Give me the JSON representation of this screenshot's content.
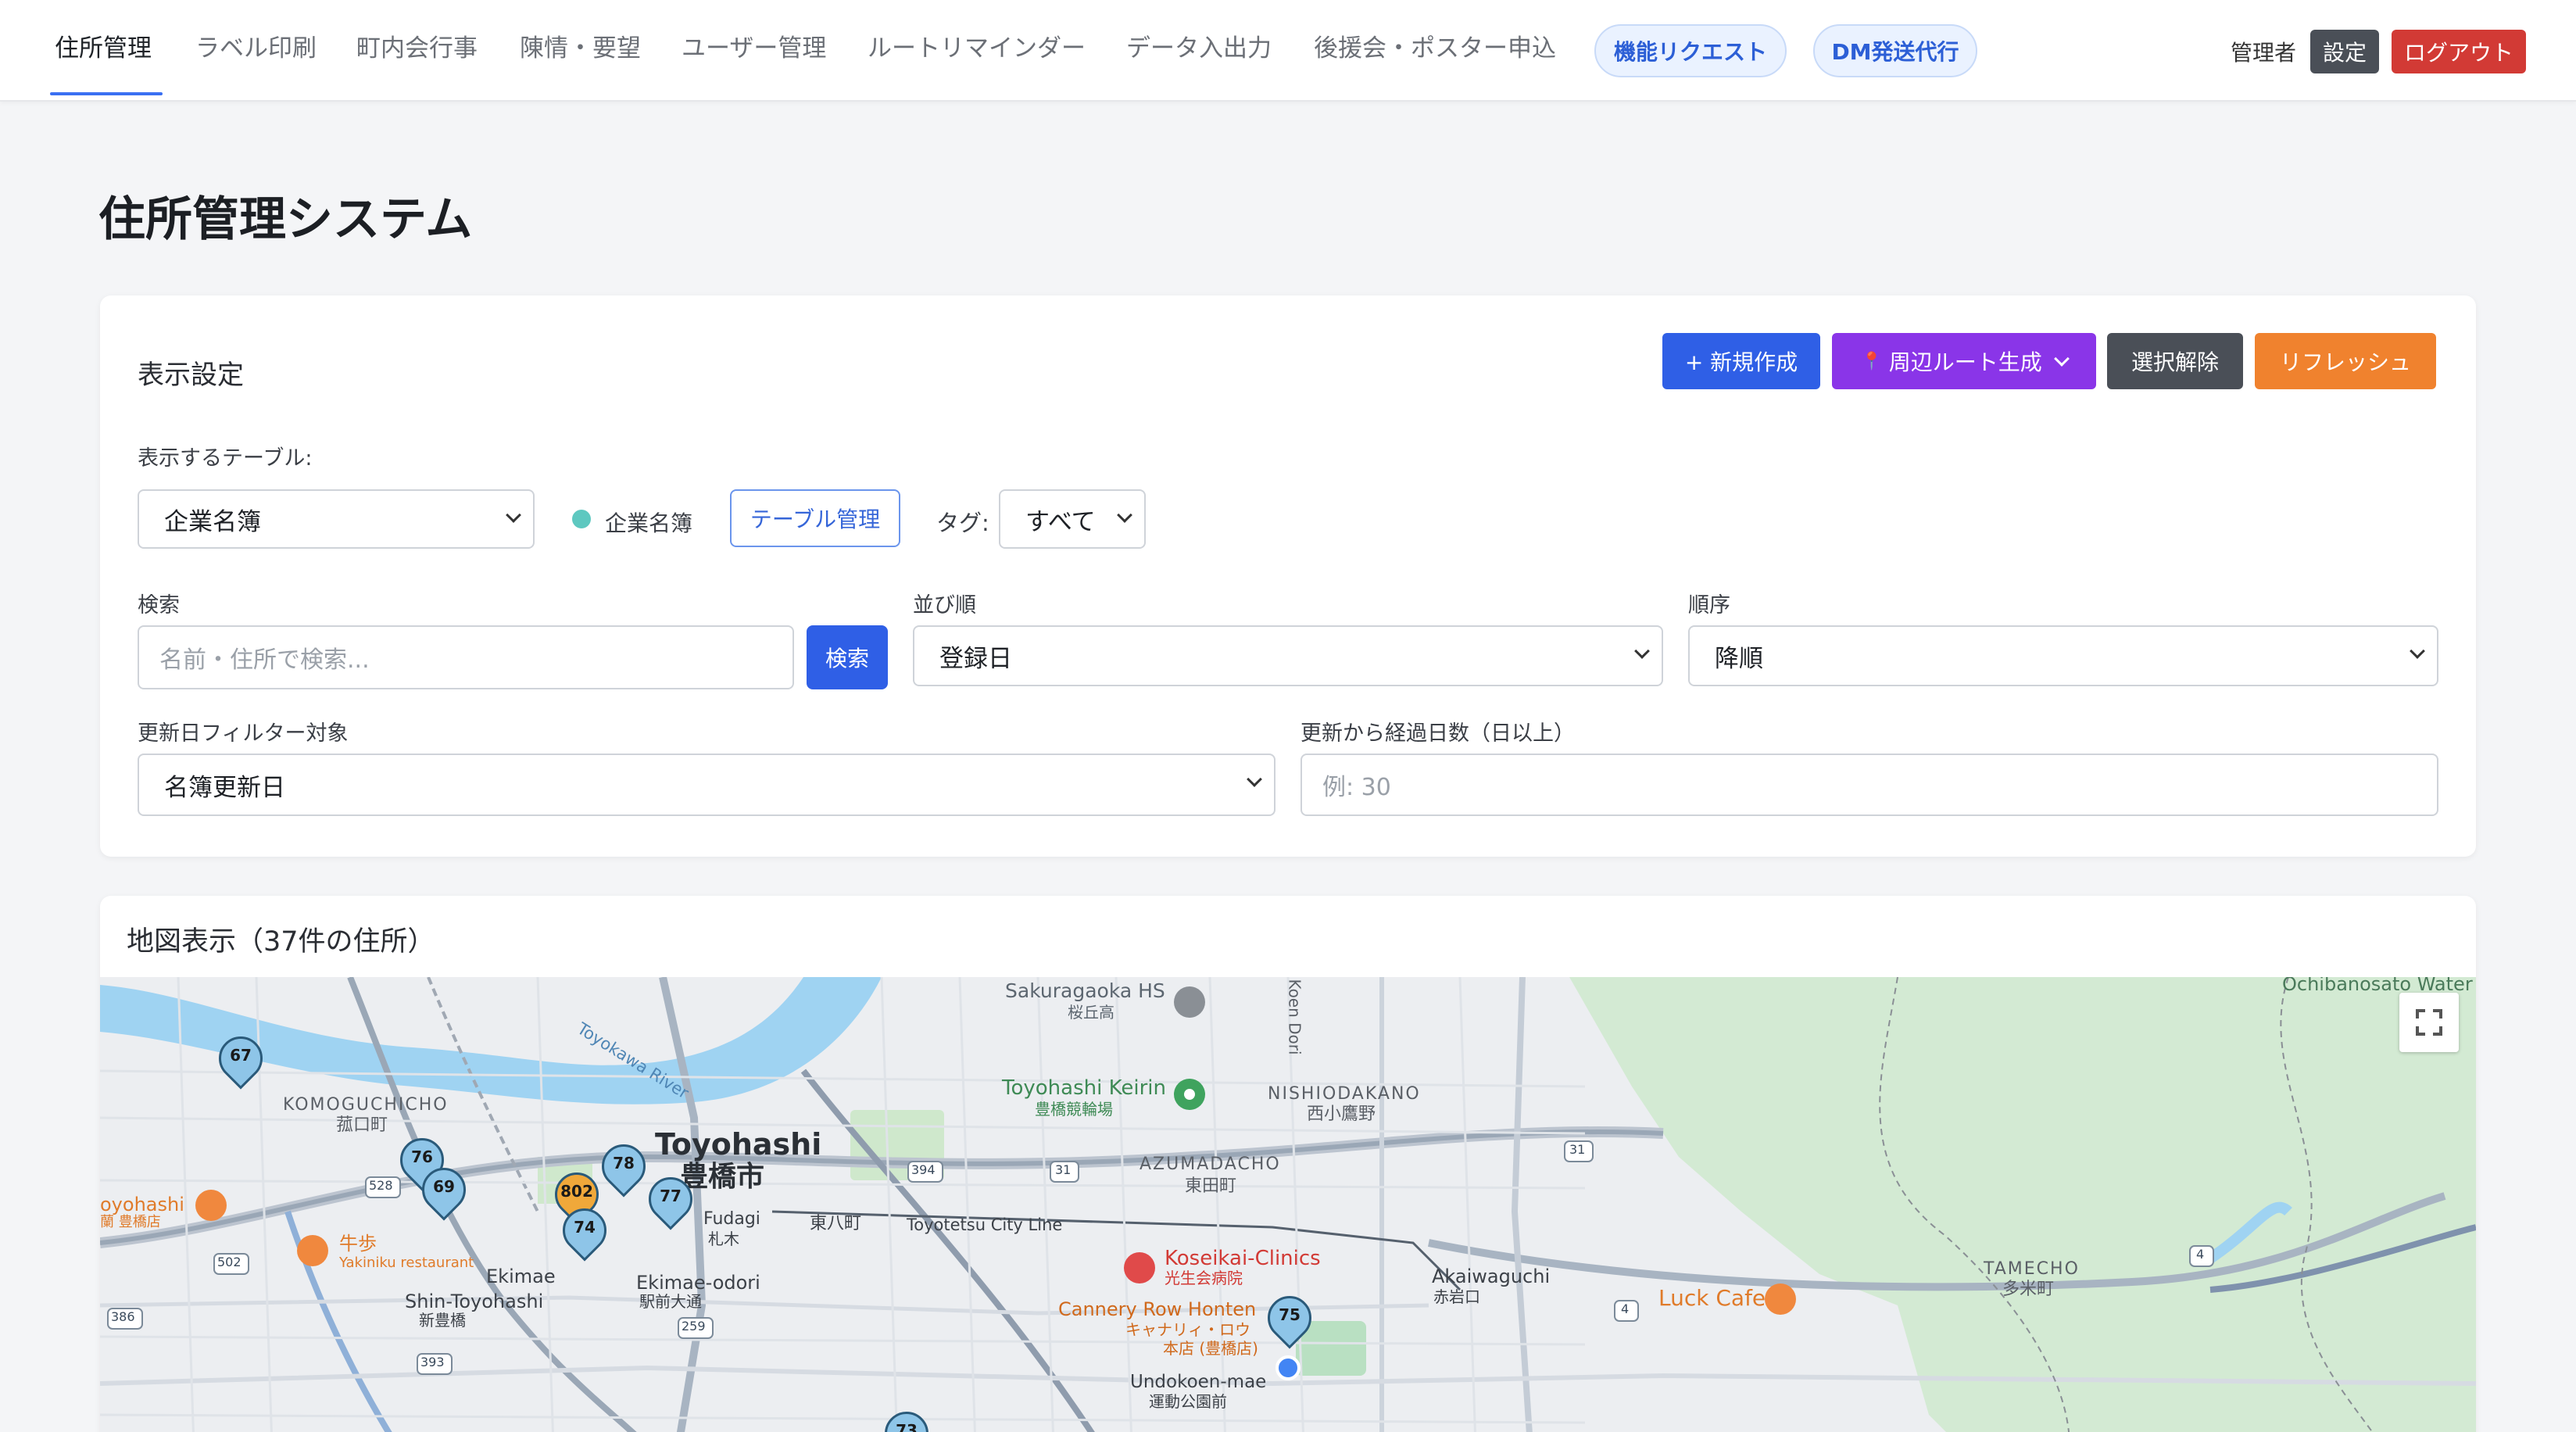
{
  "nav": {
    "items": [
      {
        "label": "住所管理"
      },
      {
        "label": "ラベル印刷"
      },
      {
        "label": "町内会行事"
      },
      {
        "label": "陳情・要望"
      },
      {
        "label": "ユーザー管理"
      },
      {
        "label": "ルートリマインダー"
      },
      {
        "label": "データ入出力"
      },
      {
        "label": "後援会・ポスター申込"
      }
    ],
    "pills": [
      {
        "label": "機能リクエスト"
      },
      {
        "label": "DM発送代行"
      }
    ],
    "user_label": "管理者",
    "settings_label": "設定",
    "logout_label": "ログアウト"
  },
  "page": {
    "title": "住所管理システム"
  },
  "settings": {
    "title": "表示設定",
    "actions": {
      "new_label": "+ 新規作成",
      "route_label": "周辺ルート生成",
      "deselect_label": "選択解除",
      "refresh_label": "リフレッシュ"
    },
    "table_label": "表示するテーブル:",
    "table_value": "企業名簿",
    "table_legend": "企業名簿",
    "table_manage_label": "テーブル管理",
    "tag_label": "タグ:",
    "tag_value": "すべて",
    "search_label": "検索",
    "search_placeholder": "名前・住所で検索...",
    "search_button": "検索",
    "sort_label": "並び順",
    "sort_value": "登録日",
    "order_label": "順序",
    "order_value": "降順",
    "update_filter_label": "更新日フィルター対象",
    "update_filter_value": "名簿更新日",
    "days_label": "更新から経過日数（日以上）",
    "days_placeholder": "例: 30"
  },
  "map": {
    "title": "地図表示（37件の住所）",
    "places": [
      {
        "text": "Sakuragaoka HS"
      },
      {
        "text": "桜丘高"
      },
      {
        "text": "Toyohashi Keirin"
      },
      {
        "text": "豊橋競輪場"
      },
      {
        "text": "NISHIODAKANO"
      },
      {
        "text": "西小鷹野"
      },
      {
        "text": "KOMOGUCHICHO"
      },
      {
        "text": "菰口町"
      },
      {
        "text": "Toyohashi"
      },
      {
        "text": "豊橋市"
      },
      {
        "text": "AZUMADACHO"
      },
      {
        "text": "東田町"
      },
      {
        "text": "Toyokawa River"
      },
      {
        "text": "東八町"
      },
      {
        "text": "Toyotetsu City Line"
      },
      {
        "text": "Koseikai-Clinics"
      },
      {
        "text": "光生会病院"
      },
      {
        "text": "Akaiwaguchi"
      },
      {
        "text": "赤岩口"
      },
      {
        "text": "Luck Cafe"
      },
      {
        "text": "TAMECHO"
      },
      {
        "text": "多米町"
      },
      {
        "text": "Ochibanosato Water"
      },
      {
        "text": "Cannery Row Honten"
      },
      {
        "text": "キャナリィ・ロウ"
      },
      {
        "text": "本店 (豊橋店)"
      },
      {
        "text": "Undokoen-mae"
      },
      {
        "text": "運動公園前"
      },
      {
        "text": "Ekimae"
      },
      {
        "text": "Ekimae-odori"
      },
      {
        "text": "駅前大通"
      },
      {
        "text": "Shin-Toyohashi"
      },
      {
        "text": "新豊橋"
      },
      {
        "text": "牛歩"
      },
      {
        "text": "Yakiniku restaurant"
      },
      {
        "text": "oyohashi"
      },
      {
        "text": "蘭 豊橋店"
      },
      {
        "text": "Fudagi"
      },
      {
        "text": "札木"
      },
      {
        "text": "Koen Dori"
      }
    ],
    "road_numbers": [
      "528",
      "502",
      "386",
      "393",
      "259",
      "394",
      "31",
      "31",
      "4",
      "4"
    ],
    "markers": [
      {
        "label": "67",
        "color": "#8ec5e8"
      },
      {
        "label": "76",
        "color": "#8ec5e8"
      },
      {
        "label": "69",
        "color": "#8ec5e8"
      },
      {
        "label": "78",
        "color": "#8ec5e8"
      },
      {
        "label": "802",
        "color": "#f0a83a"
      },
      {
        "label": "77",
        "color": "#8ec5e8"
      },
      {
        "label": "74",
        "color": "#8ec5e8"
      },
      {
        "label": "75",
        "color": "#8ec5e8"
      },
      {
        "label": "73",
        "color": "#8ec5e8"
      }
    ]
  },
  "colors": {
    "primary": "#2f5fe6",
    "purple": "#8a35e8",
    "dark": "#4a4f57",
    "orange": "#f0822e",
    "danger": "#d23a35",
    "map_water": "#9fd3f2",
    "map_park": "#cfe9cf"
  }
}
